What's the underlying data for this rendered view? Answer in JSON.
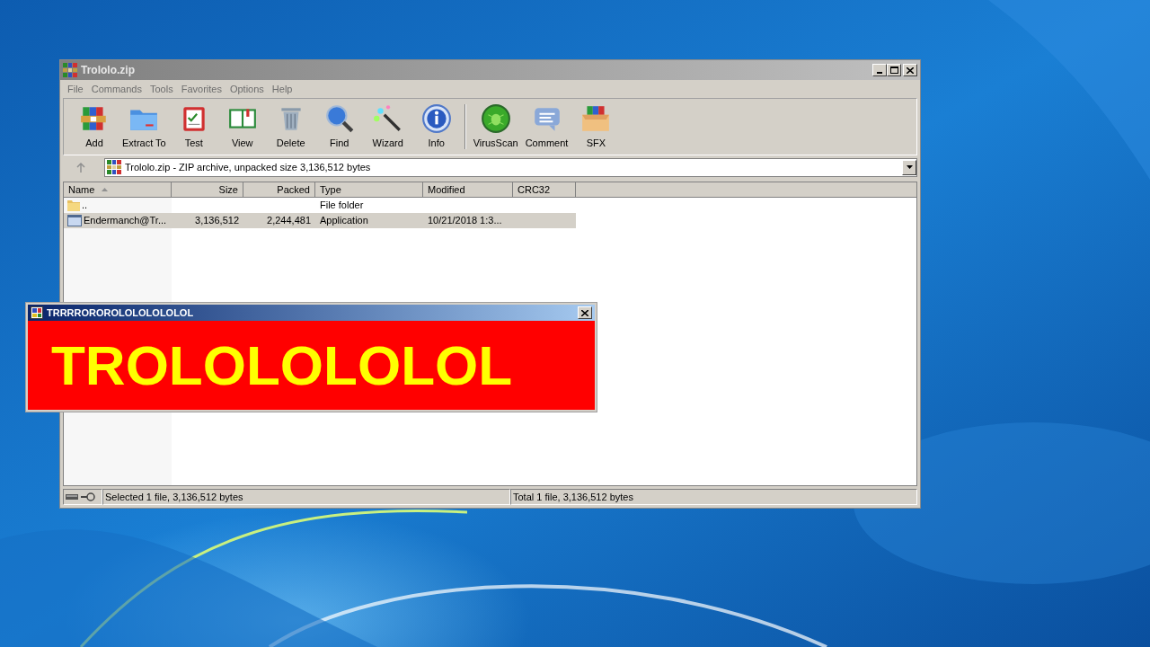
{
  "main_window": {
    "title": "Trololo.zip",
    "menu": [
      "File",
      "Commands",
      "Tools",
      "Favorites",
      "Options",
      "Help"
    ],
    "toolbar": [
      "Add",
      "Extract To",
      "Test",
      "View",
      "Delete",
      "Find",
      "Wizard",
      "Info",
      "VirusScan",
      "Comment",
      "SFX"
    ],
    "address": "Trololo.zip - ZIP archive, unpacked size 3,136,512 bytes",
    "columns": [
      {
        "label": "Name",
        "sorted": true
      },
      {
        "label": "Size",
        "sorted": false
      },
      {
        "label": "Packed",
        "sorted": false
      },
      {
        "label": "Type",
        "sorted": false
      },
      {
        "label": "Modified",
        "sorted": false
      },
      {
        "label": "CRC32",
        "sorted": false
      }
    ],
    "rows": [
      {
        "kind": "folder",
        "name": "..",
        "size": "",
        "packed": "",
        "type": "File folder",
        "modified": "",
        "selected": false
      },
      {
        "kind": "file",
        "name": "Endermanch@Tr...",
        "size": "3,136,512",
        "packed": "2,244,481",
        "type": "Application",
        "modified": "10/21/2018 1:3...",
        "selected": true
      }
    ],
    "status_left": "Selected 1 file, 3,136,512 bytes",
    "status_right": "Total 1 file, 3,136,512 bytes"
  },
  "popup": {
    "title": "TRRRROROROLOLOLOLOLOL",
    "message": "TROLOLOLOLOL"
  }
}
